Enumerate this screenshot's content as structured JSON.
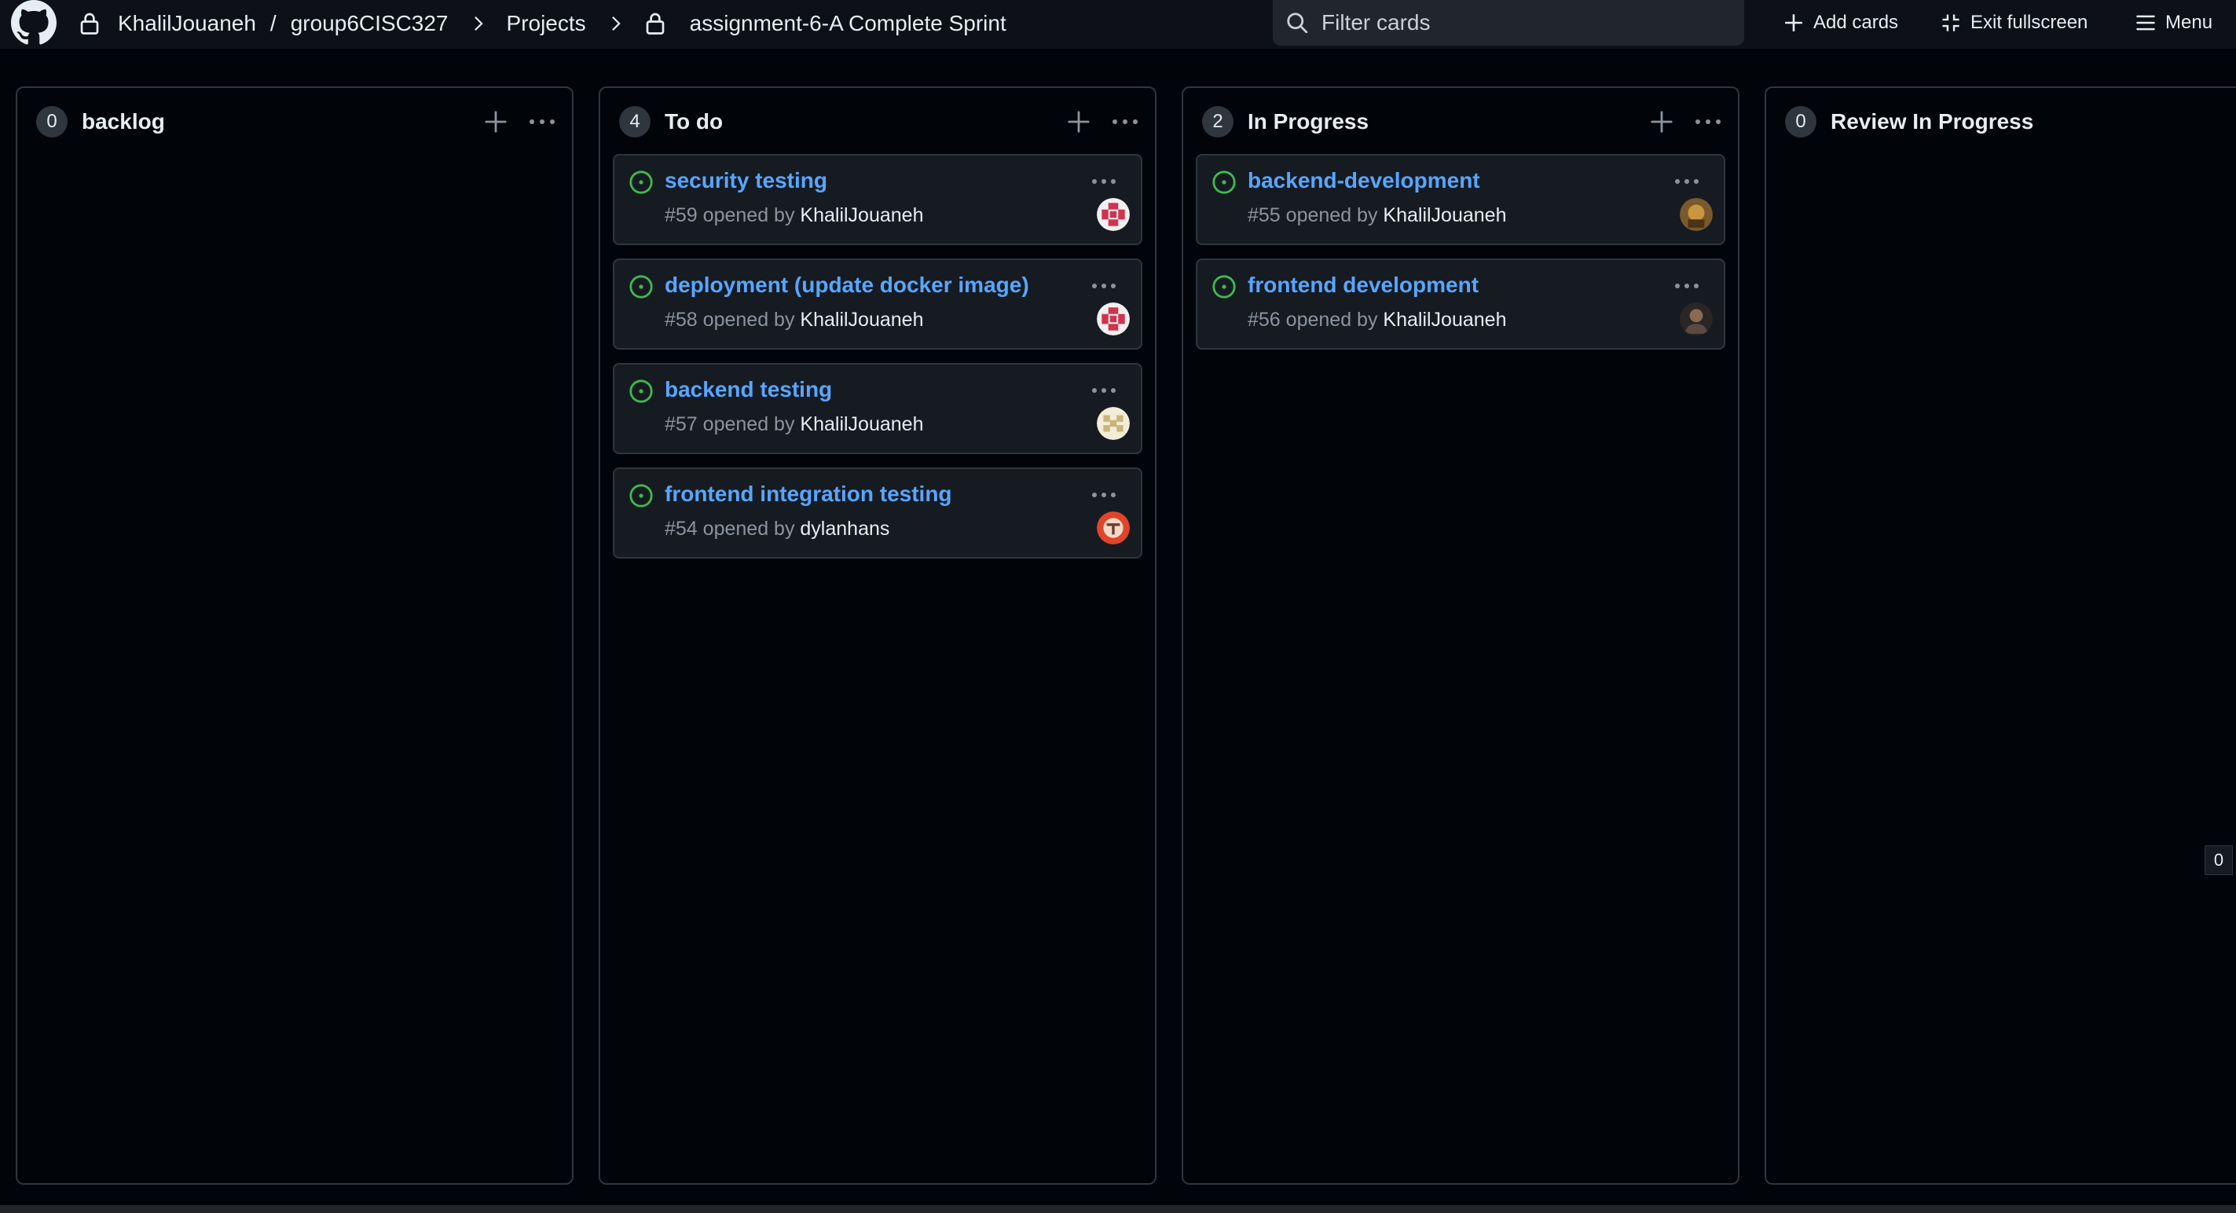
{
  "header": {
    "owner": "KhalilJouaneh",
    "separator": "/",
    "repo": "group6CISC327",
    "projects_label": "Projects",
    "project_title": "assignment-6-A Complete Sprint",
    "search_placeholder": "Filter cards",
    "add_cards_label": "Add cards",
    "exit_fullscreen_label": "Exit fullscreen",
    "menu_label": "Menu"
  },
  "columns": [
    {
      "count": "0",
      "title": "backlog",
      "cards": []
    },
    {
      "count": "4",
      "title": "To do",
      "cards": [
        {
          "title": "security testing",
          "number": "#59",
          "opened_by": "opened by",
          "author": "KhalilJouaneh",
          "avatar": "pink-identicon"
        },
        {
          "title": "deployment (update docker image)",
          "number": "#58",
          "opened_by": "opened by",
          "author": "KhalilJouaneh",
          "avatar": "pink-identicon"
        },
        {
          "title": "backend testing",
          "number": "#57",
          "opened_by": "opened by",
          "author": "KhalilJouaneh",
          "avatar": "beige-identicon"
        },
        {
          "title": "frontend integration testing",
          "number": "#54",
          "opened_by": "opened by",
          "author": "dylanhans",
          "avatar": "red-avatar"
        }
      ]
    },
    {
      "count": "2",
      "title": "In Progress",
      "cards": [
        {
          "title": "backend-development",
          "number": "#55",
          "opened_by": "opened by",
          "author": "KhalilJouaneh",
          "avatar": "brown-photo-avatar"
        },
        {
          "title": "frontend development",
          "number": "#56",
          "opened_by": "opened by",
          "author": "KhalilJouaneh",
          "avatar": "dark-photo-avatar"
        }
      ]
    },
    {
      "count": "0",
      "title": "Review In Progress",
      "cards": []
    }
  ],
  "side_badge": "0",
  "colors": {
    "background": "#010409",
    "card": "#161b22",
    "border": "#30363d",
    "link": "#58a6ff",
    "open_status": "#3fb950",
    "muted": "#8b949e"
  }
}
